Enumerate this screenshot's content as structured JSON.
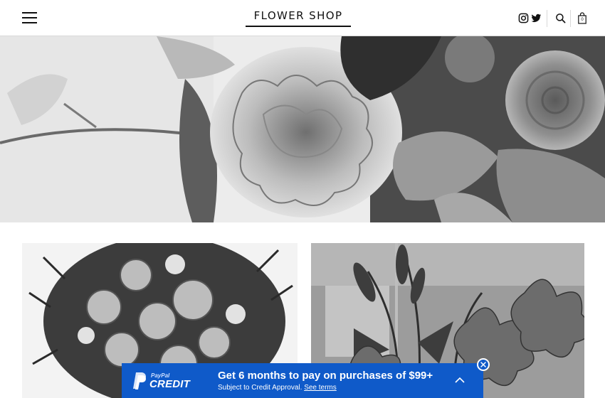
{
  "header": {
    "menu_icon": "hamburger-icon",
    "logo_text": "FLOWER SHOP",
    "social_icons": [
      "instagram-icon",
      "twitter-icon"
    ],
    "search_icon": "search-icon",
    "cart_icon": "shopping-bag-icon",
    "cart_count": "0"
  },
  "hero": {
    "image": "black-and-white carnations, roses and hydrangea leaves"
  },
  "products": [
    {
      "image": "rose bouquet with greenery"
    },
    {
      "image": "lilies in vase"
    }
  ],
  "paypal_banner": {
    "brand_small": "PayPal",
    "brand_large": "CREDIT",
    "headline": "Get 6 months to pay on purchases of $99+",
    "subtext": "Subject to Credit Approval.",
    "link_text": "See terms",
    "expand_icon": "chevron-up-icon",
    "close_icon": "close-icon",
    "color": "#0f5ac9"
  }
}
